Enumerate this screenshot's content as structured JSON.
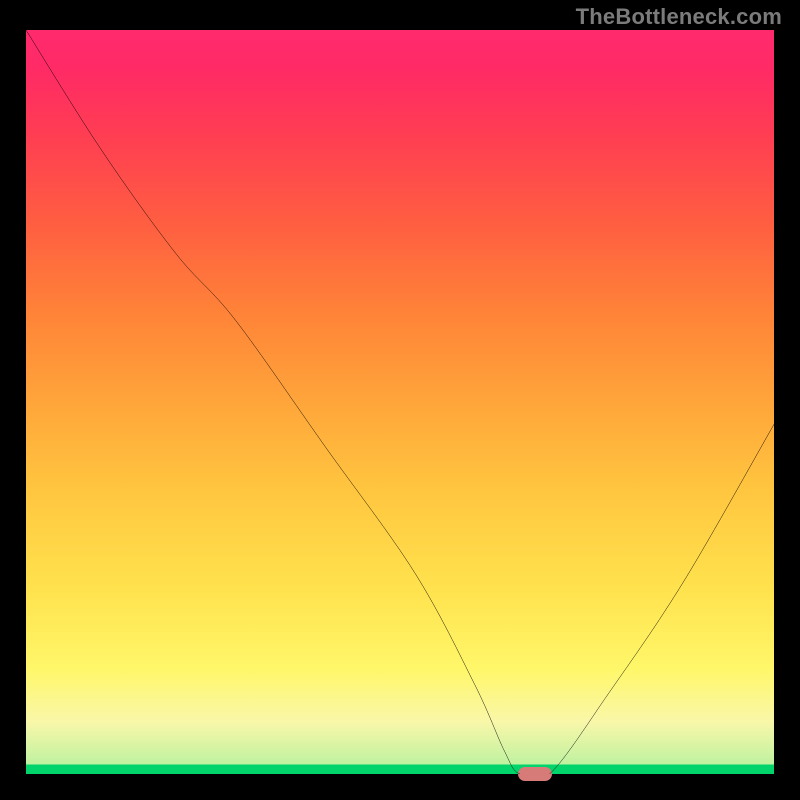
{
  "watermark": "TheBottleneck.com",
  "colors": {
    "black": "#000000",
    "gradient_top": "#ff2a6d",
    "gradient_red": "#ff3d53",
    "gradient_orange": "#ff8338",
    "gradient_yellow": "#ffe24d",
    "gradient_pale": "#f9f7a9",
    "gradient_green": "#00d46a",
    "curve_stroke": "#000000",
    "marker_fill": "#d67b78",
    "watermark_text": "#7b7b7b"
  },
  "chart_data": {
    "type": "line",
    "title": "",
    "xlabel": "",
    "ylabel": "",
    "xlim": [
      0,
      100
    ],
    "ylim": [
      0,
      100
    ],
    "grid": false,
    "legend": false,
    "series": [
      {
        "name": "bottleneck-curve",
        "x": [
          0,
          10,
          20,
          28,
          40,
          52,
          60,
          64,
          66,
          70,
          78,
          88,
          100
        ],
        "values": [
          100,
          84,
          70,
          61,
          44,
          27,
          12,
          3,
          0,
          0,
          11,
          26,
          47
        ]
      }
    ],
    "marker": {
      "x": 68,
      "y": 0,
      "label": ""
    },
    "background_gradient_meaning": "green = optimal (no bottleneck), red = severe bottleneck"
  }
}
